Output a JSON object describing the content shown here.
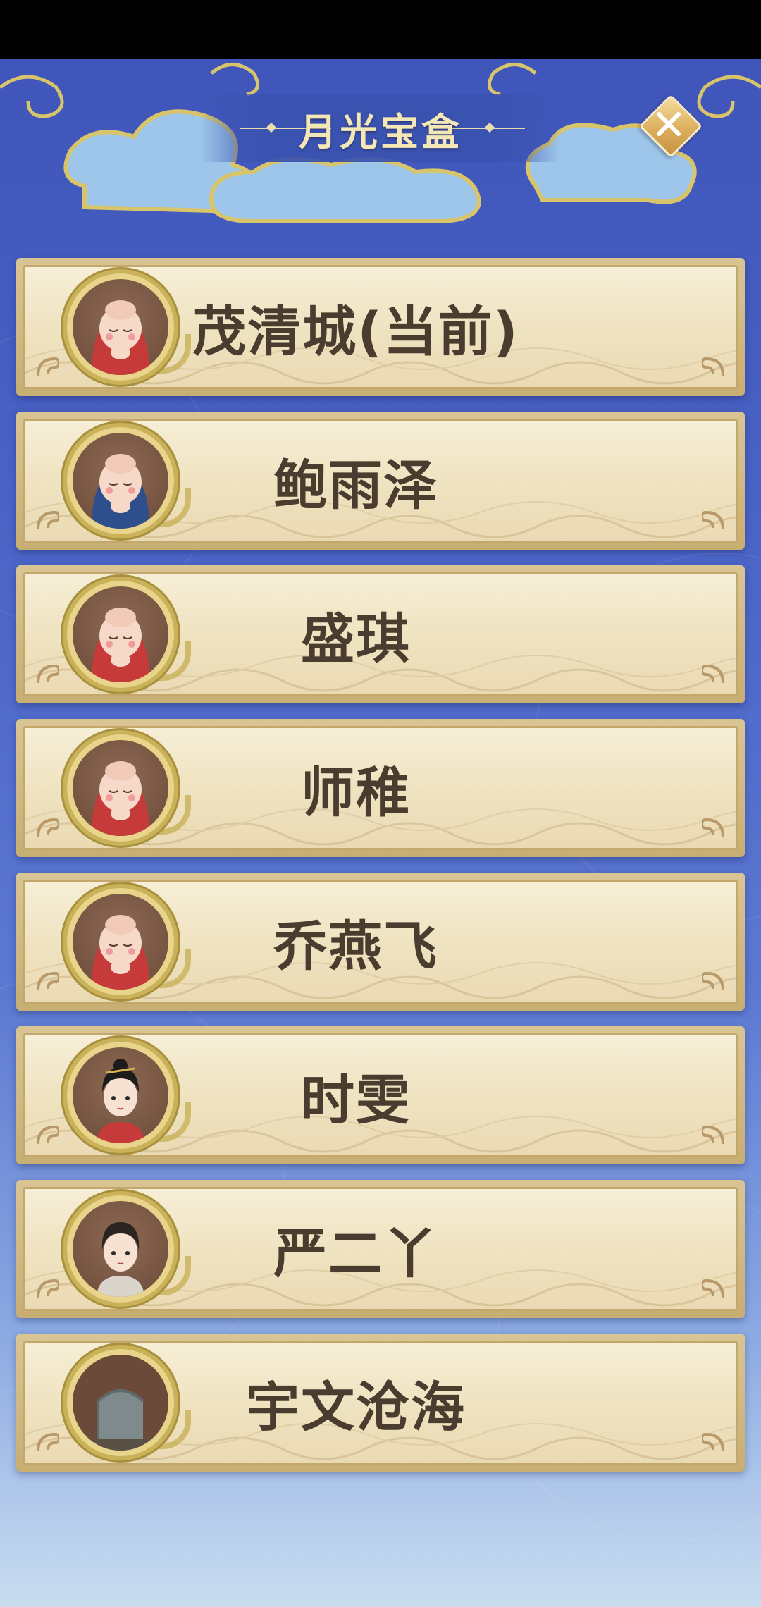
{
  "header": {
    "title": "月光宝盒",
    "close_icon": "close-icon"
  },
  "colors": {
    "background_top": "#3f55b9",
    "card": "#f2e6c6",
    "name_text": "#4b3c30",
    "title_text": "#f3e7b6",
    "close_button": "#dcae5c"
  },
  "saves": [
    {
      "name": "茂清城(当前)",
      "avatar": "baby-red-hood"
    },
    {
      "name": "鲍雨泽",
      "avatar": "baby-blue-hood"
    },
    {
      "name": "盛琪",
      "avatar": "baby-red-hood"
    },
    {
      "name": "师稚",
      "avatar": "baby-red-hood"
    },
    {
      "name": "乔燕飞",
      "avatar": "baby-red-hood"
    },
    {
      "name": "时雯",
      "avatar": "lady-hair-ornament"
    },
    {
      "name": "严二丫",
      "avatar": "young-girl"
    },
    {
      "name": "宇文沧海",
      "avatar": "tombstone"
    }
  ]
}
